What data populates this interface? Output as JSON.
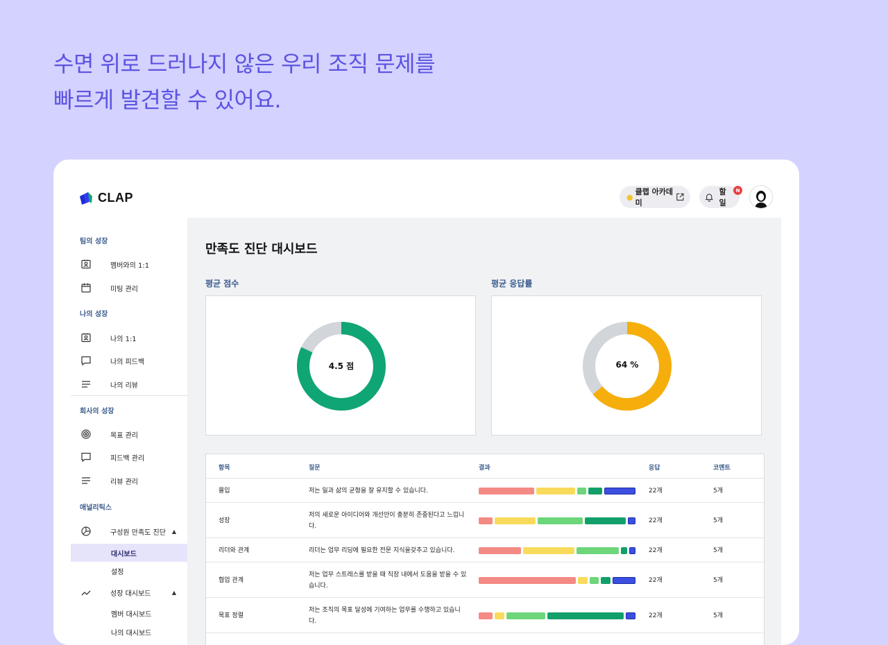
{
  "headline": {
    "line1": "수면 위로 드러나지 않은 우리 조직 문제를",
    "line2": "빠르게 발견할 수 있어요."
  },
  "brand": {
    "name": "CLAP"
  },
  "header": {
    "academy_label": "클랩 아카데미",
    "todo_label": "할 일",
    "badge": "N"
  },
  "sidebar": {
    "team_title": "팀의 성장",
    "team_items": [
      {
        "label": "멤버와의 1:1",
        "icon": "contact-card-icon"
      },
      {
        "label": "미팅 관리",
        "icon": "calendar-icon"
      }
    ],
    "my_title": "나의 성장",
    "my_items": [
      {
        "label": "나의 1:1",
        "icon": "contact-card-icon"
      },
      {
        "label": "나의 피드백",
        "icon": "chat-bubble-icon"
      },
      {
        "label": "나의 리뷰",
        "icon": "lines-icon"
      }
    ],
    "company_title": "회사의 성장",
    "company_items": [
      {
        "label": "목표 관리",
        "icon": "target-icon"
      },
      {
        "label": "피드백 관리",
        "icon": "chat-bubble-icon"
      },
      {
        "label": "리뷰 관리",
        "icon": "lines-icon"
      }
    ],
    "analytics_title": "애널리틱스",
    "satisfaction": {
      "label": "구성원 만족도 진단",
      "icon": "pie-icon",
      "sub": [
        "대시보드",
        "설정"
      ]
    },
    "growth": {
      "label": "성장 대시보드",
      "icon": "trend-icon",
      "sub": [
        "멤버 대시보드",
        "나의 대시보드"
      ]
    }
  },
  "main": {
    "title": "만족도 진단 대시보드",
    "avg_score": {
      "label": "평균 점수",
      "center": "4.5 점",
      "fraction": 0.82,
      "color": "#10a574"
    },
    "response_rate": {
      "label": "평균 응답률",
      "center": "64 %",
      "fraction": 0.64,
      "color": "#f5ae0b"
    },
    "donut_track_color": "#d2d5da",
    "table": {
      "headers": [
        "항목",
        "질문",
        "결과",
        "응답",
        "코멘트"
      ],
      "segment_colors": [
        "#f48a84",
        "#f9db5c",
        "#6dd67a",
        "#12a06a",
        "#3b4fe0"
      ],
      "rows": [
        {
          "item": "몰입",
          "question": [
            "저는 일과 삶의 균형을 잘 유지할 수 있습니다."
          ],
          "dist": [
            36,
            25,
            6,
            9,
            20
          ],
          "responses": "22개",
          "comments": "5개"
        },
        {
          "item": "성장",
          "question": [
            "저의 새로운 아이디어와 개선안이 충분히 존중된다고 느낍니",
            "다."
          ],
          "dist": [
            9,
            26,
            29,
            26,
            5
          ],
          "responses": "22개",
          "comments": "5개"
        },
        {
          "item": "리더와 관계",
          "question": [
            "리더는 업무 리딩에 필요한 전문 지식을갖추고 있습니다."
          ],
          "dist": [
            27,
            33,
            27,
            4,
            4
          ],
          "responses": "22개",
          "comments": "5개"
        },
        {
          "item": "협업 관계",
          "question": [
            "저는 업무 스트레스를 받을 때 직장 내에서 도움을 받을 수 있",
            "습니다."
          ],
          "dist": [
            63,
            6,
            6,
            6,
            15
          ],
          "responses": "22개",
          "comments": "5개"
        },
        {
          "item": "목표 정렬",
          "question": [
            "저는 조직의 목표 달성에 기여하는 업무를 수행하고 있습니",
            "다."
          ],
          "dist": [
            9,
            6,
            25,
            49,
            6
          ],
          "responses": "22개",
          "comments": "5개"
        }
      ]
    }
  }
}
